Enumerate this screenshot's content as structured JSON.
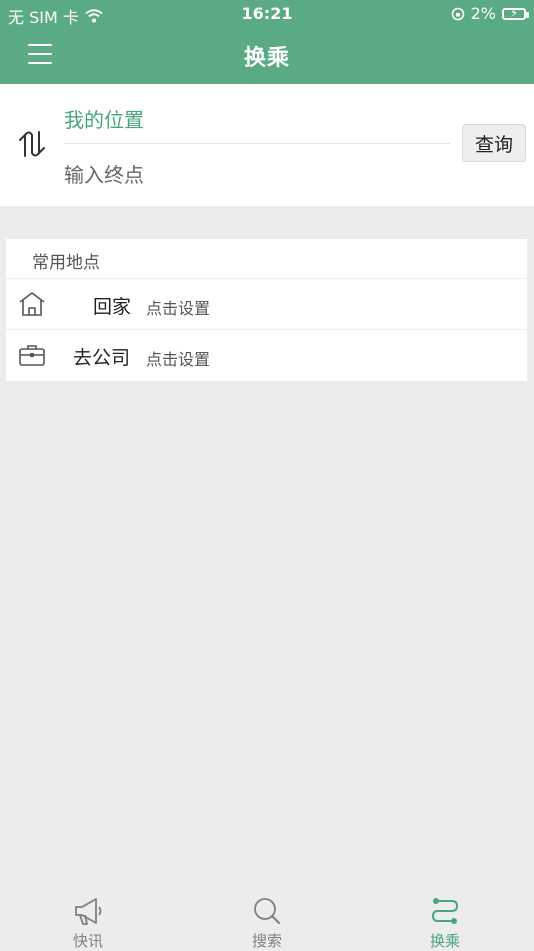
{
  "status": {
    "carrier": "无 SIM 卡",
    "time": "16:21",
    "battery": "2%"
  },
  "header": {
    "title": "换乘"
  },
  "route": {
    "from": "我的位置",
    "to_placeholder": "输入终点",
    "query_label": "查询"
  },
  "places": {
    "heading": "常用地点",
    "items": [
      {
        "name": "回家",
        "hint": "点击设置",
        "icon": "home-icon"
      },
      {
        "name": "去公司",
        "hint": "点击设置",
        "icon": "briefcase-icon"
      }
    ]
  },
  "tabs": [
    {
      "label": "快讯",
      "icon": "megaphone-icon"
    },
    {
      "label": "搜索",
      "icon": "search-icon"
    },
    {
      "label": "换乘",
      "icon": "route-icon",
      "active": true
    }
  ],
  "colors": {
    "brand": "#5aaa84",
    "accent_text": "#4aa57d",
    "background": "#ececec"
  }
}
